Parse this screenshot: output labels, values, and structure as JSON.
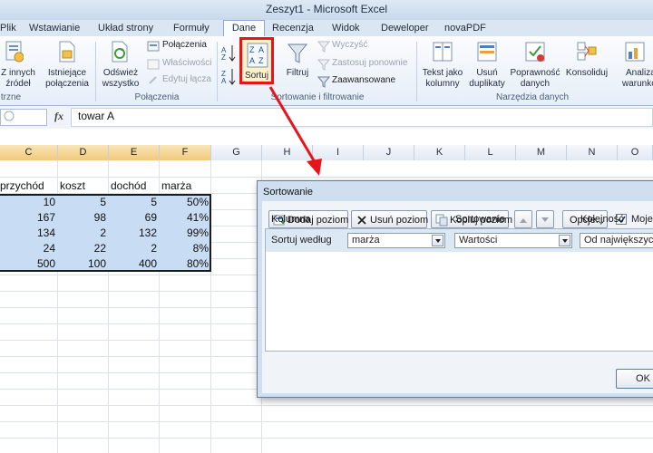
{
  "window": {
    "title": "Zeszyt1 - Microsoft Excel"
  },
  "tabs": [
    {
      "label": "Plik"
    },
    {
      "label": "Wstawianie"
    },
    {
      "label": "Układ strony"
    },
    {
      "label": "Formuły"
    },
    {
      "label": "Dane",
      "active": true
    },
    {
      "label": "Recenzja"
    },
    {
      "label": "Widok"
    },
    {
      "label": "Deweloper"
    },
    {
      "label": "novaPDF"
    }
  ],
  "ribbon": {
    "from_other_1": "Z innych",
    "from_other_2": "źródeł",
    "existing_1": "Istniejące",
    "existing_2": "połączenia",
    "group_external_suffix": "trzne",
    "refresh_1": "Odśwież",
    "refresh_2": "wszystko",
    "connections": "Połączenia",
    "properties": "Właściwości",
    "edit_links": "Edytuj łącza",
    "group_connections": "Połączenia",
    "sort": "Sortuj",
    "filter": "Filtruj",
    "clear": "Wyczyść",
    "reapply": "Zastosuj ponownie",
    "advanced": "Zaawansowane",
    "group_sort_filter": "Sortowanie i filtrowanie",
    "text_to_columns_1": "Tekst jako",
    "text_to_columns_2": "kolumny",
    "remove_dup_1": "Usuń",
    "remove_dup_2": "duplikaty",
    "validation_1": "Poprawność",
    "validation_2": "danych",
    "consolidate": "Konsoliduj",
    "whatif_1": "Analiza",
    "whatif_2": "warunkow",
    "group_data_tools": "Narzędzia danych"
  },
  "formula_bar": {
    "fx": "fx",
    "value": "towar A"
  },
  "sheet": {
    "columns": [
      "C",
      "D",
      "E",
      "F",
      "G",
      "H",
      "I",
      "J",
      "K",
      "L",
      "M",
      "N",
      "O"
    ],
    "headers": [
      "przychód",
      "koszt",
      "dochód",
      "marża"
    ],
    "rows": [
      [
        "10",
        "5",
        "5",
        "50%"
      ],
      [
        "167",
        "98",
        "69",
        "41%"
      ],
      [
        "134",
        "2",
        "132",
        "99%"
      ],
      [
        "24",
        "22",
        "2",
        "8%"
      ],
      [
        "500",
        "100",
        "400",
        "80%"
      ]
    ]
  },
  "dialog": {
    "title": "Sortowanie",
    "add_level": "Dodaj poziom",
    "delete_level": "Usuń poziom",
    "copy_level": "Kopiuj poziom",
    "options": "Opcje...",
    "my_data_headers": "Moje d",
    "col_header_column": "Kolumna",
    "col_header_sort_on": "Sortowanie",
    "col_header_order": "Kolejność",
    "row_label": "Sortuj według",
    "column_value": "marża",
    "sort_on_value": "Wartości",
    "order_value": "Od największych d",
    "ok": "OK"
  },
  "annotation": {
    "highlight_color": "#e8141c"
  }
}
